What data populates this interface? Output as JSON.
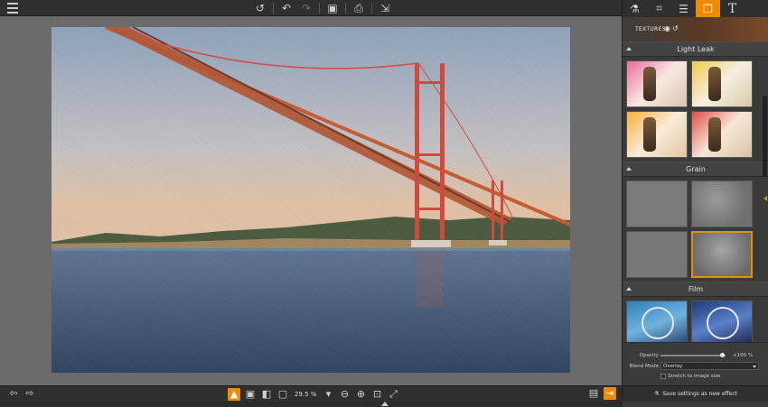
{
  "toolbar": {
    "menu_icon": "menu-icon",
    "undo_all_icon": "undo-all-icon",
    "undo_icon": "undo-icon",
    "redo_icon": "redo-icon",
    "save_icon": "save-icon",
    "print_icon": "print-icon",
    "share_icon": "share-icon"
  },
  "panel": {
    "tabs": [
      {
        "name": "flask-icon",
        "glyph": "⚗"
      },
      {
        "name": "crop-icon",
        "glyph": "⌗"
      },
      {
        "name": "adjust-icon",
        "glyph": "☰"
      },
      {
        "name": "layers-icon",
        "glyph": "❐"
      },
      {
        "name": "text-icon",
        "glyph": "T"
      }
    ],
    "textures_label": "TEXTURES",
    "sections": [
      {
        "title": "Light Leak"
      },
      {
        "title": "Grain"
      },
      {
        "title": "Film"
      }
    ],
    "opacity_label": "Opacity",
    "opacity_value": "+100 %",
    "opacity_fraction": 0.95,
    "blend_mode_label": "Blend Mode",
    "blend_mode_value": "Overlay",
    "stretch_label": "Stretch to image size",
    "save_label": "Save settings as new effect"
  },
  "bottom": {
    "zoom": "29.5 %"
  },
  "colors": {
    "accent": "#f08a00",
    "panel_bg": "#3b3b3b",
    "canvas_bg": "#6b6b6b"
  }
}
